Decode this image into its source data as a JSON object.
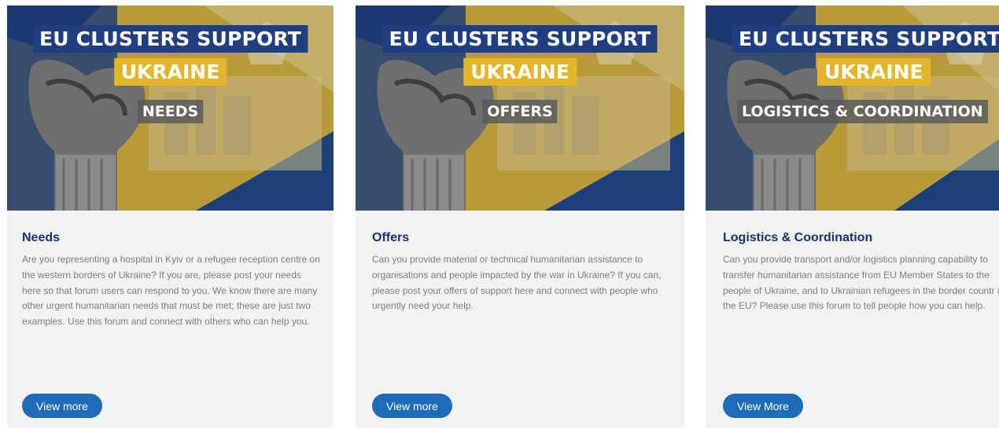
{
  "cards": [
    {
      "banner_line1": "EU CLUSTERS SUPPORT",
      "banner_line2": "UKRAINE",
      "banner_line3": "NEEDS",
      "title": "Needs",
      "description": "Are you representing a hospital in Kyiv or a refugee reception centre on the western borders of Ukraine? If you are, please post your needs here so that forum users can respond to you. We know there are many other urgent humanitarian needs that must be met; these are just two examples. Use this forum and connect with others who can help you.",
      "button": "View more"
    },
    {
      "banner_line1": "EU CLUSTERS SUPPORT",
      "banner_line2": "UKRAINE",
      "banner_line3": "OFFERS",
      "title": "Offers",
      "description": "Can you provide material or technical humanitarian assistance to organisations and people impacted by the war in Ukraine? If you can, please post your offers of support here and connect with people who urgently need your help.",
      "button": "View more"
    },
    {
      "banner_line1": "EU CLUSTERS SUPPORT",
      "banner_line2": "UKRAINE",
      "banner_line3": "LOGISTICS & COORDINATION",
      "title": "Logistics & Coordination",
      "description": "Can you provide transport and/or logistics planning capability to transfer humanitarian assistance from EU Member States to the people of Ukraine, and to Ukrainian refugees in the border countr of the EU? Please use this forum to tell people how you can help.",
      "button": "View More"
    }
  ],
  "colors": {
    "title": "#16336e",
    "button": "#1e6bb8",
    "banner_blue": "#1f3f80",
    "banner_yellow": "#e3b52a",
    "card_bg": "#f2f2f2"
  }
}
